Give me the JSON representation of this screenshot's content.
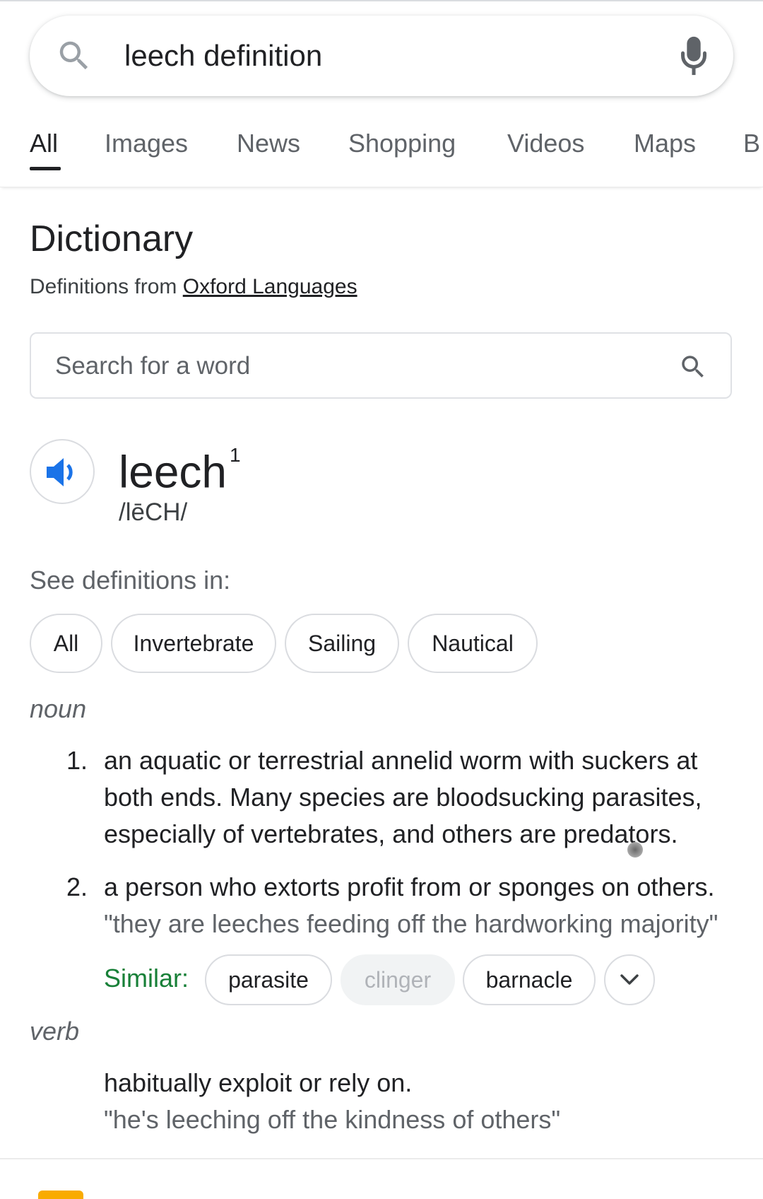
{
  "search": {
    "query": "leech definition",
    "search_icon": "search-icon",
    "mic_icon": "microphone-icon"
  },
  "tabs": [
    {
      "label": "All",
      "active": true
    },
    {
      "label": "Images"
    },
    {
      "label": "News"
    },
    {
      "label": "Shopping"
    },
    {
      "label": "Videos"
    },
    {
      "label": "Maps"
    },
    {
      "label": "B"
    }
  ],
  "dictionary": {
    "title": "Dictionary",
    "source_prefix": "Definitions from ",
    "source_link": "Oxford Languages",
    "search_placeholder": "Search for a word",
    "word": "leech",
    "superscript": "1",
    "phonetic": "/lēCH/",
    "see_definitions_label": "See definitions in:",
    "categories": [
      "All",
      "Invertebrate",
      "Sailing",
      "Nautical"
    ],
    "noun": {
      "pos": "noun",
      "definitions": [
        {
          "number": "1.",
          "text": "an aquatic or terrestrial annelid worm with suckers at both ends. Many species are bloodsucking parasites, especially of vertebrates, and others are predators."
        },
        {
          "number": "2.",
          "text": "a person who extorts profit from or sponges on others.",
          "example": "\"they are leeches feeding off the hardworking majority\""
        }
      ],
      "similar_label": "Similar:",
      "similar": [
        {
          "word": "parasite",
          "disabled": false
        },
        {
          "word": "clinger",
          "disabled": true
        },
        {
          "word": "barnacle",
          "disabled": false
        }
      ],
      "expand_icon": "chevron-down-icon"
    },
    "verb": {
      "pos": "verb",
      "text": "habitually exploit or rely on.",
      "example": "\"he's leeching off the kindness of others\""
    }
  },
  "colors": {
    "accent_blue": "#1a73e8",
    "similar_green": "#188038",
    "text_primary": "#202124",
    "text_secondary": "#5f6368",
    "border": "#dadce0"
  }
}
